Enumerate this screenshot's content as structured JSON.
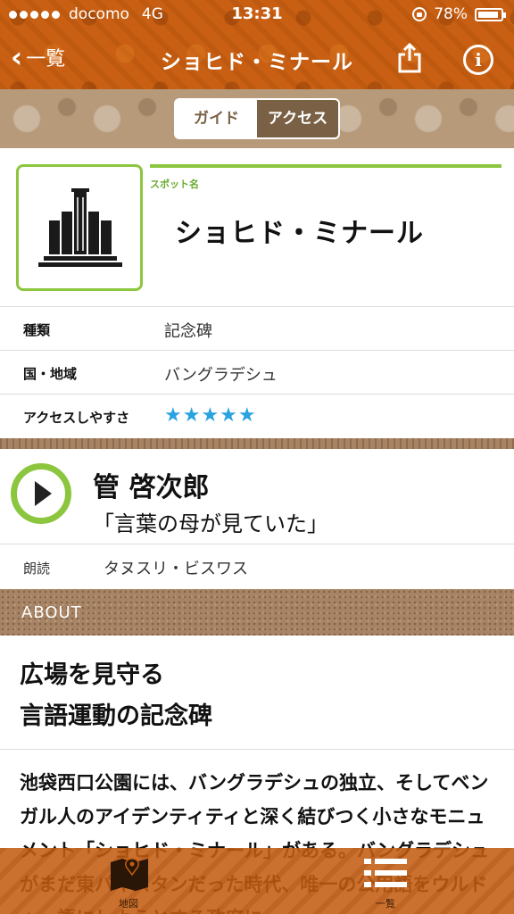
{
  "status_bar": {
    "carrier": "docomo",
    "network": "4G",
    "time": "13:31",
    "battery": "78%"
  },
  "nav": {
    "back_label": "一覧",
    "title": "ショヒド・ミナール"
  },
  "segment": {
    "guide": "ガイド",
    "access": "アクセス",
    "selected": "アクセス"
  },
  "spot": {
    "label": "スポット名",
    "name": "ショヒド・ミナール",
    "icon": "monument-icon"
  },
  "attributes": [
    {
      "key": "種類",
      "value": "記念碑"
    },
    {
      "key": "国・地域",
      "value": "バングラデシュ"
    },
    {
      "key": "アクセスしやすさ",
      "value": "★★★★★"
    }
  ],
  "audio": {
    "author": "管 啓次郎",
    "work": "「言葉の母が見ていた」",
    "reader_label": "朗読",
    "reader": "タヌスリ・ビスワス"
  },
  "about": {
    "section": "ABOUT",
    "headline_1": "広場を見守る",
    "headline_2": "言語運動の記念碑",
    "body": "池袋西口公園には、バングラデシュの独立、そしてベンガル人のアイデンティティと深く結びつく小さなモニュメント「ショヒド・ミナール」がある。バングラデシュがまだ東パキスタンだった時代、唯一の公用語をウルドゥー語にしようとする政府に"
  },
  "tabbar": {
    "map_label": "地図",
    "list_label": "一覧"
  },
  "colors": {
    "accent_green": "#8cc63f",
    "brand_orange": "#c85f12",
    "segment_brown": "#7a6044",
    "star_blue": "#29a3e0"
  }
}
